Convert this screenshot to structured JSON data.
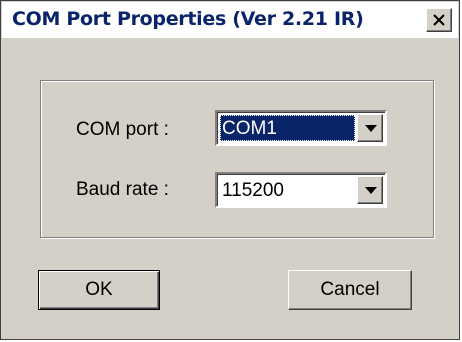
{
  "window": {
    "title": "COM Port Properties (Ver 2.21 IR)",
    "close_label": "X"
  },
  "form": {
    "com_port": {
      "label": "COM port :",
      "value": "COM1"
    },
    "baud_rate": {
      "label": "Baud rate :",
      "value": "115200"
    }
  },
  "buttons": {
    "ok_label": "OK",
    "cancel_label": "Cancel"
  },
  "colors": {
    "face": "#d4d0c8",
    "title_text": "#0a246a",
    "selection": "#0a246a"
  },
  "icons": {
    "close": "close-icon",
    "dropdown": "chevron-down-icon"
  }
}
